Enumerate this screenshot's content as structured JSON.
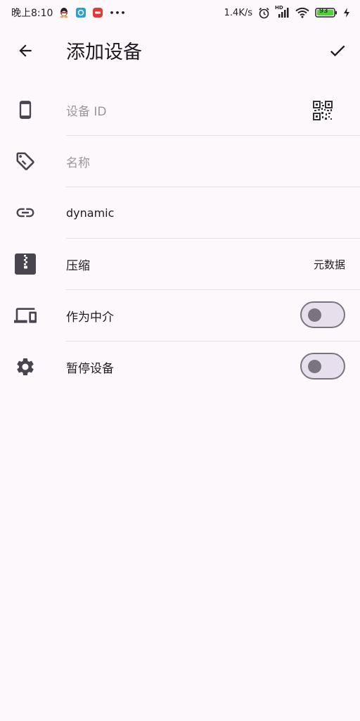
{
  "status_bar": {
    "time": "晚上8:10",
    "more": "•••",
    "net_speed": "1.4K/s",
    "hd": "HD",
    "battery": "93"
  },
  "app_bar": {
    "title": "添加设备"
  },
  "fields": {
    "device_id_placeholder": "设备 ID",
    "name_placeholder": "名称",
    "address": "dynamic"
  },
  "settings": {
    "compression_label": "压缩",
    "compression_value": "元数据",
    "introducer_label": "作为中介",
    "introducer_on": false,
    "paused_label": "暂停设备",
    "paused_on": false
  },
  "colors": {
    "background": "#fdf8fc",
    "icon": "#49454f",
    "divider": "#e6e0e5",
    "switch_outline": "#79747e",
    "switch_track": "#e7e0ec",
    "battery_green": "#4cd137"
  }
}
